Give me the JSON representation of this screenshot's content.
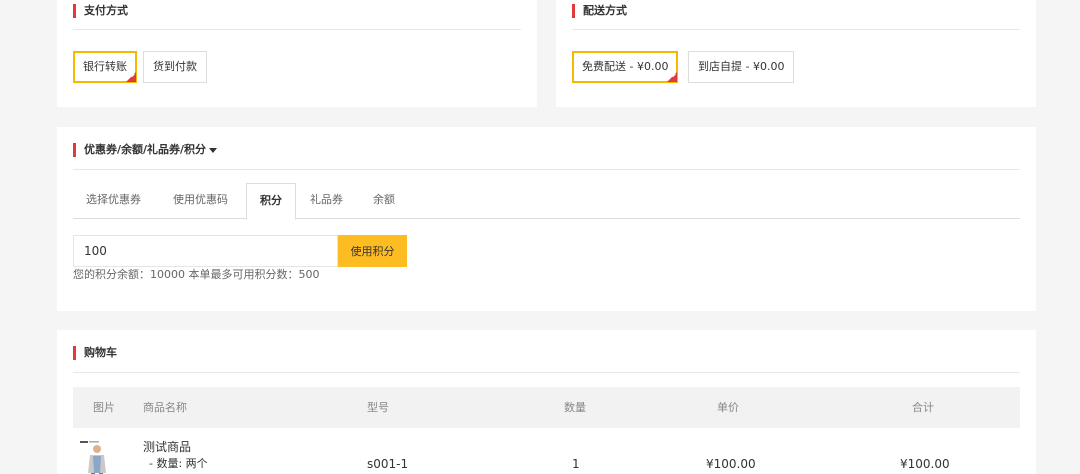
{
  "payment": {
    "title": "支付方式",
    "options": [
      {
        "label": "银行转账",
        "selected": true
      },
      {
        "label": "货到付款",
        "selected": false
      }
    ]
  },
  "shipping": {
    "title": "配送方式",
    "options": [
      {
        "label": "免费配送 - ¥0.00",
        "selected": true
      },
      {
        "label": "到店自提 - ¥0.00",
        "selected": false
      }
    ]
  },
  "discount": {
    "title": "优惠券/余额/礼品券/积分",
    "tabs": [
      "选择优惠券",
      "使用优惠码",
      "积分",
      "礼品券",
      "余额"
    ],
    "active_tab": "积分",
    "points_input_value": "100",
    "use_points_label": "使用积分",
    "points_hint": "您的积分余额：10000 本单最多可用积分数：500"
  },
  "cart": {
    "title": "购物车",
    "headers": [
      "图片",
      "商品名称",
      "型号",
      "数量",
      "单价",
      "合计"
    ],
    "rows": [
      {
        "name": "测试商品",
        "option": "- 数量: 两个",
        "model": "s001-1",
        "qty": "1",
        "unit_price": "¥100.00",
        "total": "¥100.00"
      }
    ]
  },
  "colors": {
    "accent_red": "#e4393c",
    "accent_yellow": "#fdbc21",
    "background": "#f5f5f5"
  }
}
